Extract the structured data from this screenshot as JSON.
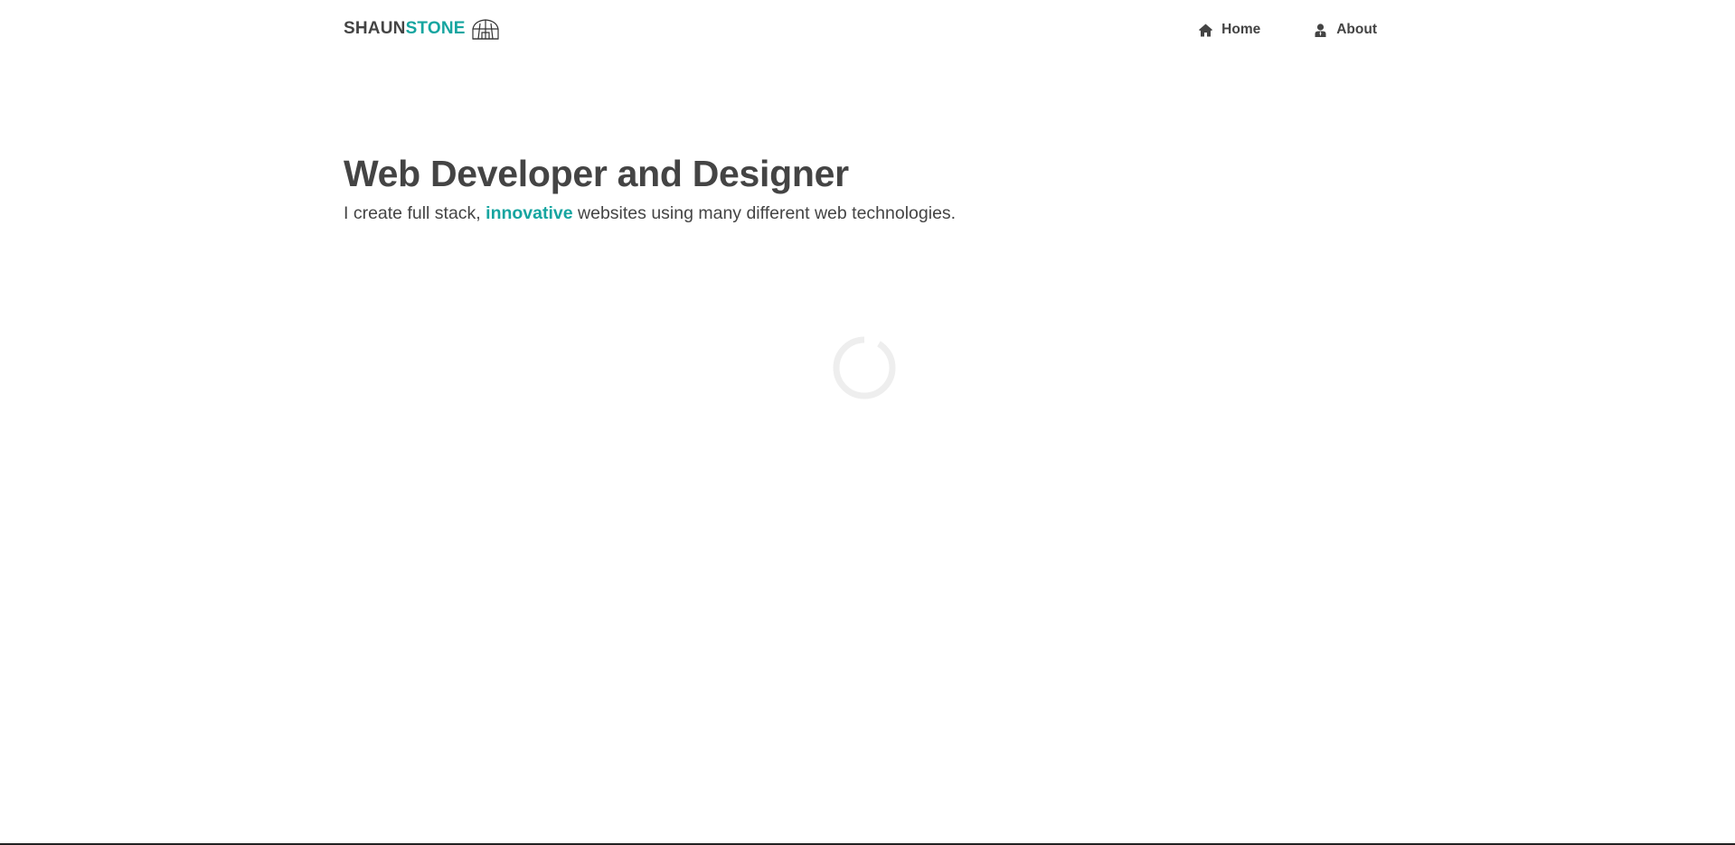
{
  "header": {
    "brand_first": "SHAUN",
    "brand_last": "STONE",
    "brand_logo_icon": "dome-icon",
    "brand_accent_color": "#16a5a0",
    "nav": [
      {
        "label": "Home",
        "icon": "home-icon"
      },
      {
        "label": "About",
        "icon": "user-icon"
      }
    ]
  },
  "hero": {
    "title": "Web Developer and Designer",
    "subtitle_before": "I create full stack,",
    "subtitle_accent": "innovative",
    "subtitle_after": "websites using many different web technologies."
  },
  "loader": {
    "icon": "loading-spinner-icon"
  }
}
